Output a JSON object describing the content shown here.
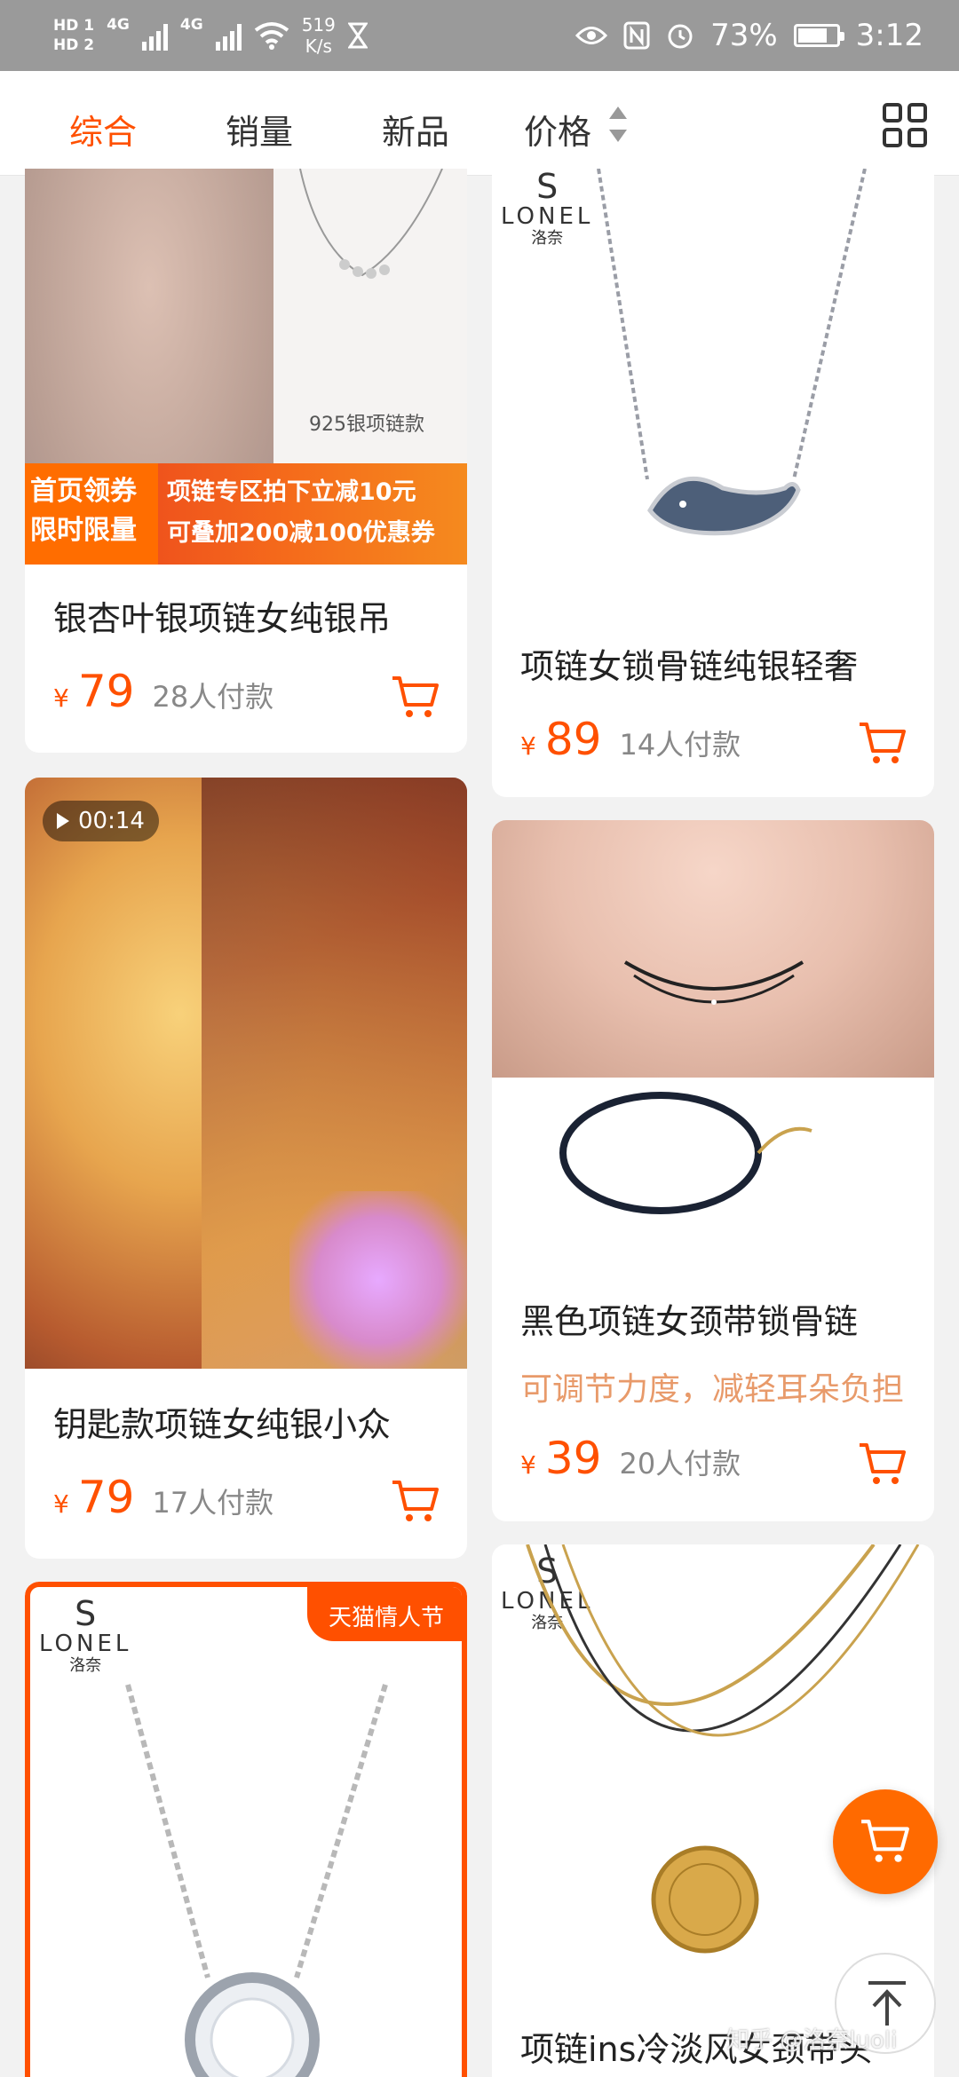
{
  "status_bar": {
    "hd1": "HD 1",
    "hd2": "HD 2",
    "net1": "4G",
    "net2": "4G",
    "speed_value": "519",
    "speed_unit": "K/s",
    "battery": "73%",
    "time": "3:12"
  },
  "sort_bar": {
    "tabs": [
      "综合",
      "销量",
      "新品",
      "价格"
    ],
    "active_tab": "综合"
  },
  "products": [
    {
      "title": "银杏叶银项链女纯银吊",
      "price_symbol": "¥",
      "price": "79",
      "sales": "28人付款",
      "image_caption": "925银项链款",
      "banner_left": [
        "首页领券",
        "限时限量"
      ],
      "banner_right": [
        "项链专区拍下立减10元",
        "可叠加200减100优惠券"
      ]
    },
    {
      "title": "项链女锁骨链纯银轻奢",
      "price_symbol": "¥",
      "price": "89",
      "sales": "14人付款",
      "brand": {
        "mark": "S",
        "name": "LONEL",
        "cn": "洛奈"
      }
    },
    {
      "title": "钥匙款项链女纯银小众",
      "price_symbol": "¥",
      "price": "79",
      "sales": "17人付款",
      "video_duration": "00:14"
    },
    {
      "title": "黑色项链女颈带锁骨链",
      "subtitle": "可调节力度，减轻耳朵负担",
      "price_symbol": "¥",
      "price": "39",
      "sales": "20人付款"
    },
    {
      "badge": "天猫情人节",
      "brand": {
        "mark": "S",
        "name": "LONEL",
        "cn": "洛奈"
      }
    },
    {
      "title": "项链ins冷淡风女颈带头",
      "brand": {
        "mark": "S",
        "name": "LONEL",
        "cn": "洛奈"
      }
    }
  ],
  "watermark": "知乎 @洛奈luoli",
  "colors": {
    "accent": "#ff5000",
    "status_bar": "#9a9a9a",
    "background": "#f2f2f2"
  }
}
